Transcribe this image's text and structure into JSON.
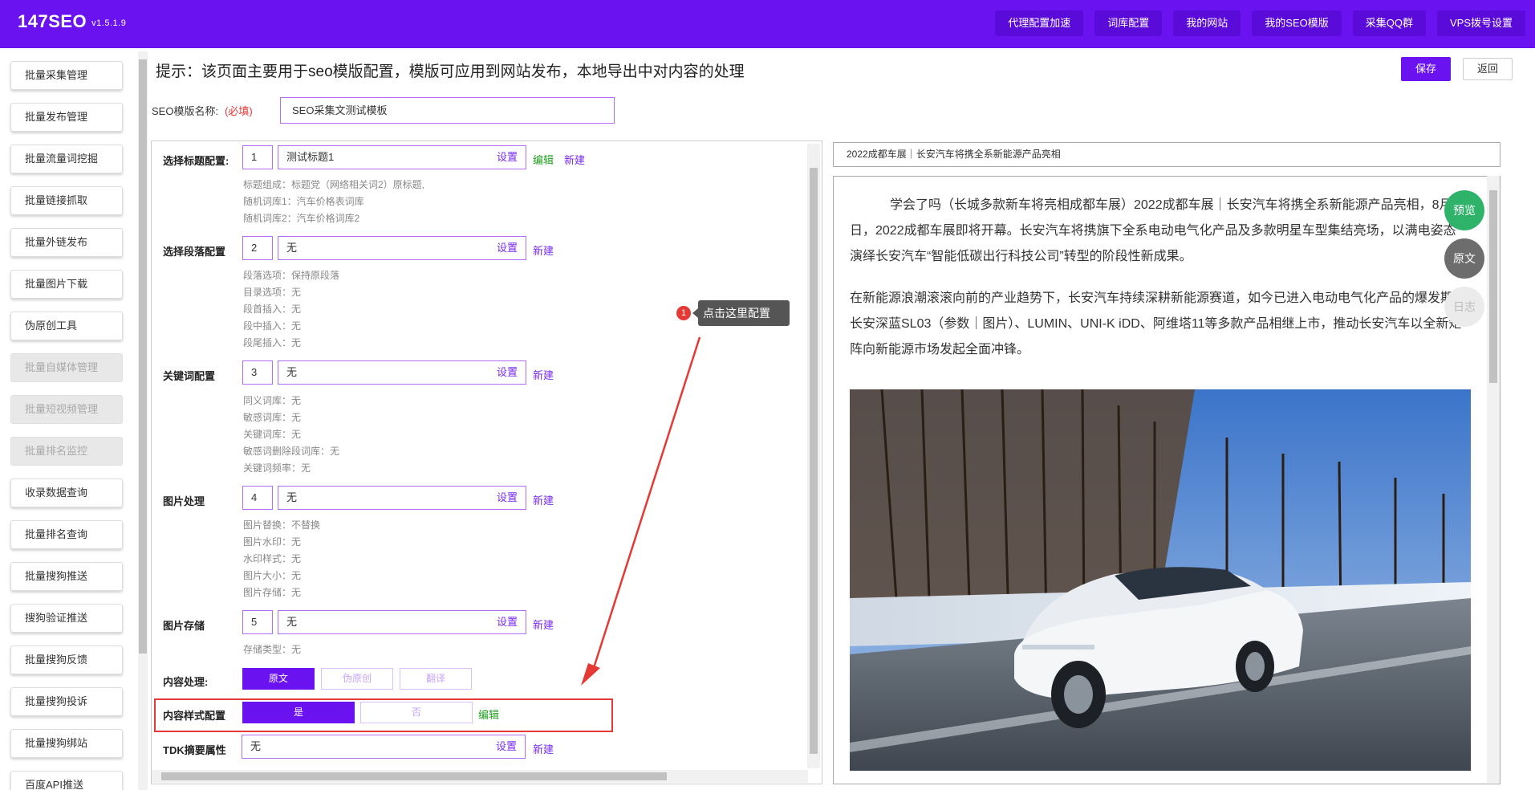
{
  "header": {
    "brand": "147SEO",
    "version": "v1.5.1.9",
    "nav": [
      "代理配置加速",
      "词库配置",
      "我的网站",
      "我的SEO模版",
      "采集QQ群",
      "VPS拨号设置"
    ]
  },
  "sidebar": {
    "items": [
      {
        "label": "批量采集管理",
        "disabled": false
      },
      {
        "label": "批量发布管理",
        "disabled": false
      },
      {
        "label": "批量流量词挖掘",
        "disabled": false
      },
      {
        "label": "批量链接抓取",
        "disabled": false
      },
      {
        "label": "批量外链发布",
        "disabled": false
      },
      {
        "label": "批量图片下载",
        "disabled": false
      },
      {
        "label": "伪原创工具",
        "disabled": false
      },
      {
        "label": "批量自媒体管理",
        "disabled": true
      },
      {
        "label": "批量短视频管理",
        "disabled": true
      },
      {
        "label": "批量排名监控",
        "disabled": true
      },
      {
        "label": "收录数据查询",
        "disabled": false
      },
      {
        "label": "批量排名查询",
        "disabled": false
      },
      {
        "label": "批量搜狗推送",
        "disabled": false
      },
      {
        "label": "搜狗验证推送",
        "disabled": false
      },
      {
        "label": "批量搜狗反馈",
        "disabled": false
      },
      {
        "label": "批量搜狗投诉",
        "disabled": false
      },
      {
        "label": "批量搜狗绑站",
        "disabled": false
      },
      {
        "label": "百度API推送",
        "disabled": false
      }
    ]
  },
  "page": {
    "tip": "提示：该页面主要用于seo模版配置，模版可应用到网站发布，本地导出中对内容的处理",
    "save_label": "保存",
    "back_label": "返回",
    "name_label": "SEO模版名称:",
    "name_required": "(必填)",
    "name_value": "SEO采集文测试模板"
  },
  "config": {
    "title": {
      "label": "选择标题配置:",
      "num": "1",
      "value": "测试标题1",
      "set": "设置",
      "edit": "编辑",
      "new": "新建",
      "desc": [
        "标题组成：标题党（网络相关词2）原标题,",
        "随机词库1：汽车价格表词库",
        "随机词库2：汽车价格词库2"
      ]
    },
    "paragraph": {
      "label": "选择段落配置",
      "num": "2",
      "value": "无",
      "set": "设置",
      "new": "新建",
      "desc": [
        "段落选项：保持原段落",
        "目录选项：无",
        "段首插入：无",
        "段中插入：无",
        "段尾插入：无"
      ]
    },
    "keyword": {
      "label": "关键词配置",
      "num": "3",
      "value": "无",
      "set": "设置",
      "new": "新建",
      "desc": [
        "同义词库：无",
        "敏感词库：无",
        "关键词库：无",
        "敏感词删除段词库：无",
        "关键词频率：无"
      ]
    },
    "image": {
      "label": "图片处理",
      "num": "4",
      "value": "无",
      "set": "设置",
      "new": "新建",
      "desc": [
        "图片替换：不替换",
        "图片水印：无",
        "水印样式：无",
        "图片大小：无",
        "图片存储：无"
      ]
    },
    "storage": {
      "label": "图片存储",
      "num": "5",
      "value": "无",
      "set": "设置",
      "new": "新建",
      "desc": [
        "存储类型：无"
      ]
    },
    "content": {
      "label": "内容处理:",
      "options": [
        "原文",
        "伪原创",
        "翻译"
      ],
      "selected": "原文"
    },
    "style": {
      "label": "内容样式配置",
      "options": [
        "是",
        "否"
      ],
      "selected": "是",
      "edit": "编辑"
    },
    "tdk": {
      "label": "TDK摘要属性",
      "value": "无",
      "set": "设置",
      "new": "新建"
    }
  },
  "annotation": {
    "badge": "1",
    "text": "点击这里配置"
  },
  "preview": {
    "title": "2022成都车展｜长安汽车将携全系新能源产品亮相",
    "p1": "学会了吗（长城多款新车将亮相成都车展）2022成都车展｜长安汽车将携全系新能源产品亮相，8月26日，2022成都车展即将开幕。长安汽车将携旗下全系电动电气化产品及多款明星车型集结亮场，以满电姿态演绎长安汽车“智能低碳出行科技公司”转型的阶段性新成果。",
    "p2": "在新能源浪潮滚滚向前的产业趋势下，长安汽车持续深耕新能源赛道，如今已进入电动电气化产品的爆发期，长安深蓝SL03（参数｜图片）、LUMIN、UNI-K iDD、阿维塔11等多款产品相继上市，推动长安汽车以全新矩阵向新能源市场发起全面冲锋。",
    "floating": [
      "预览",
      "原文",
      "日志"
    ]
  },
  "colors": {
    "accent": "#6a12ef",
    "edit": "#1fa01f",
    "alert": "#e53935"
  }
}
